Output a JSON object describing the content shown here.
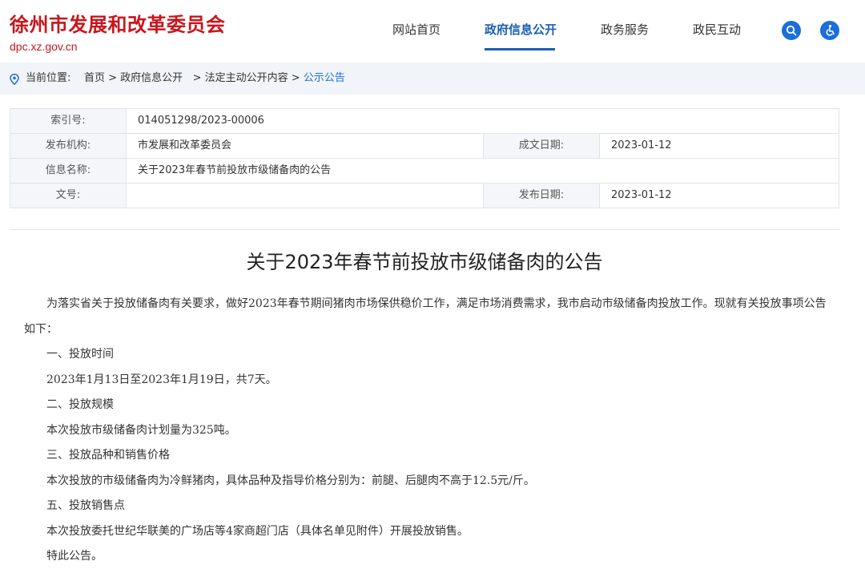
{
  "header": {
    "site_title": "徐州市发展和改革委员会",
    "site_domain": "dpc.xz.gov.cn",
    "nav": [
      {
        "label": "网站首页"
      },
      {
        "label": "政府信息公开",
        "active": true
      },
      {
        "label": "政务服务"
      },
      {
        "label": "政民互动"
      }
    ],
    "icons": [
      "search-icon",
      "accessibility-icon"
    ],
    "accent_color": "#1a5fb4",
    "brand_color": "#c8161d"
  },
  "breadcrumb": {
    "prefix": "当前位置:",
    "items": [
      "首页",
      "政府信息公开",
      "法定主动公开内容",
      "公示公告"
    ],
    "separator": ">"
  },
  "info": {
    "index_label": "索引号:",
    "index_value": "014051298/2023-00006",
    "org_label": "发布机构:",
    "org_value": "市发展和改革委员会",
    "created_label": "成文日期:",
    "created_value": "2023-01-12",
    "name_label": "信息名称:",
    "name_value": "关于2023年春节前投放市级储备肉的公告",
    "docno_label": "文号:",
    "docno_value": "",
    "published_label": "发布日期:",
    "published_value": "2023-01-12"
  },
  "article": {
    "title": "关于2023年春节前投放市级储备肉的公告",
    "paragraphs": [
      "为落实省关于投放储备肉有关要求，做好2023年春节期间猪肉市场保供稳价工作，满足市场消费需求，我市启动市级储备肉投放工作。现就有关投放事项公告如下：",
      "一、投放时间",
      "2023年1月13日至2023年1月19日，共7天。",
      "二、投放规模",
      "本次投放市级储备肉计划量为325吨。",
      "三、投放品种和销售价格",
      "本次投放的市级储备肉为冷鲜猪肉，具体品种及指导价格分别为：前腿、后腿肉不高于12.5元/斤。",
      "五、投放销售点",
      "本次投放委托世纪华联美的广场店等4家商超门店（具体名单见附件）开展投放销售。",
      "特此公告。"
    ]
  }
}
